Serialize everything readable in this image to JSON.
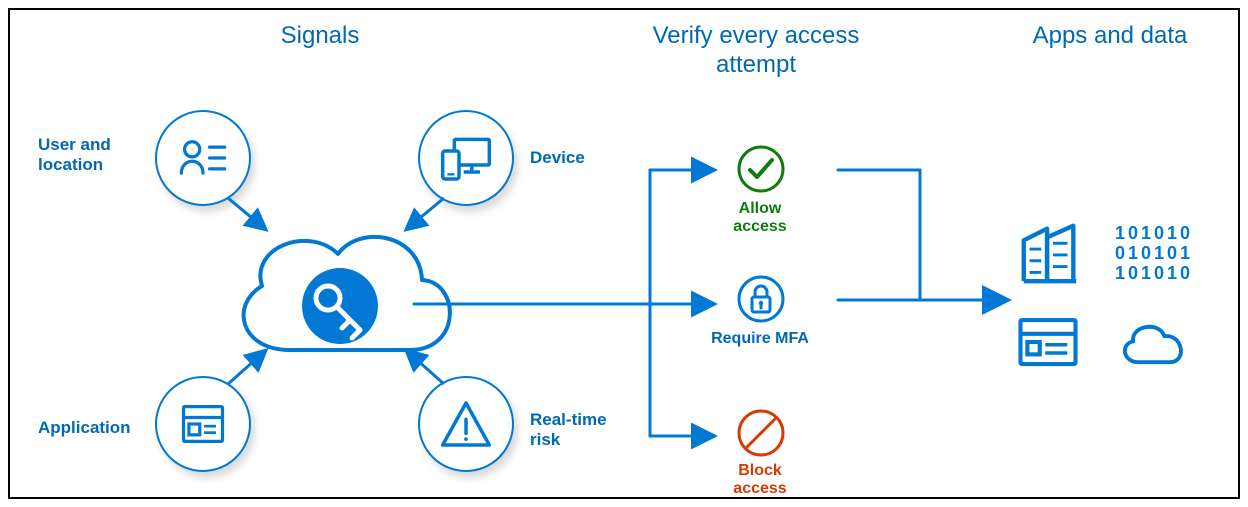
{
  "headings": {
    "signals": "Signals",
    "verify": "Verify every access attempt",
    "apps": "Apps and data"
  },
  "signals": {
    "user": "User and location",
    "device": "Device",
    "application": "Application",
    "risk": "Real-time risk"
  },
  "verify": {
    "allow": "Allow access",
    "mfa": "Require MFA",
    "block": "Block access"
  },
  "apps_binary": "101010\n010101\n101010",
  "colors": {
    "blue": "#0078d4",
    "headingBlue": "#0069b3",
    "green": "#107c10",
    "orange": "#d83b01"
  }
}
